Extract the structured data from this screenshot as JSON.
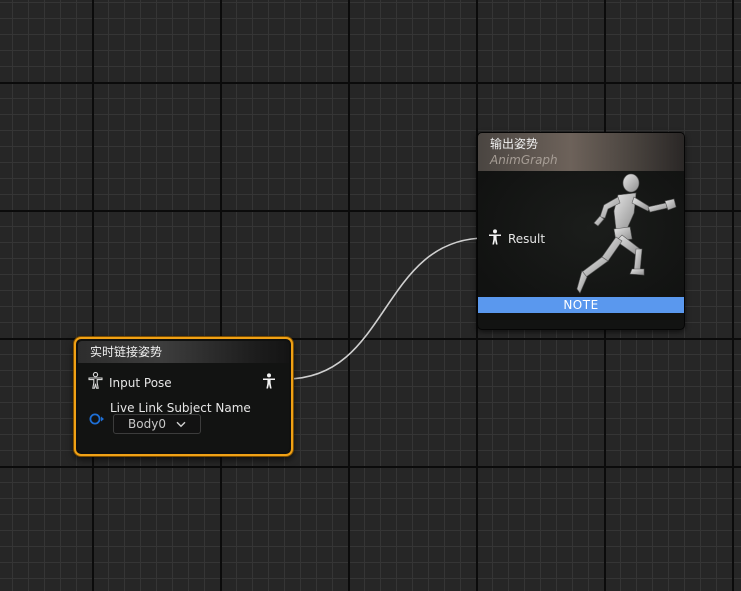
{
  "output_node": {
    "title": "输出姿势",
    "subtitle": "AnimGraph",
    "result_pin_label": "Result",
    "note_label": "NOTE",
    "note_color": "#5a98ee",
    "icons": [
      "pose-icon",
      "mannequin-preview"
    ]
  },
  "livelink_node": {
    "title": "实时链接姿势",
    "input_pose_label": "Input Pose",
    "subject_name_label": "Live Link Subject Name",
    "subject_value": "Body0",
    "selection_border_color": "#f0a116",
    "name_pin_color": "#1e6fd6",
    "icons": [
      "pose-icon",
      "name-pin-icon",
      "chevron-down-icon"
    ]
  },
  "wire_color": "#cfcfcf"
}
